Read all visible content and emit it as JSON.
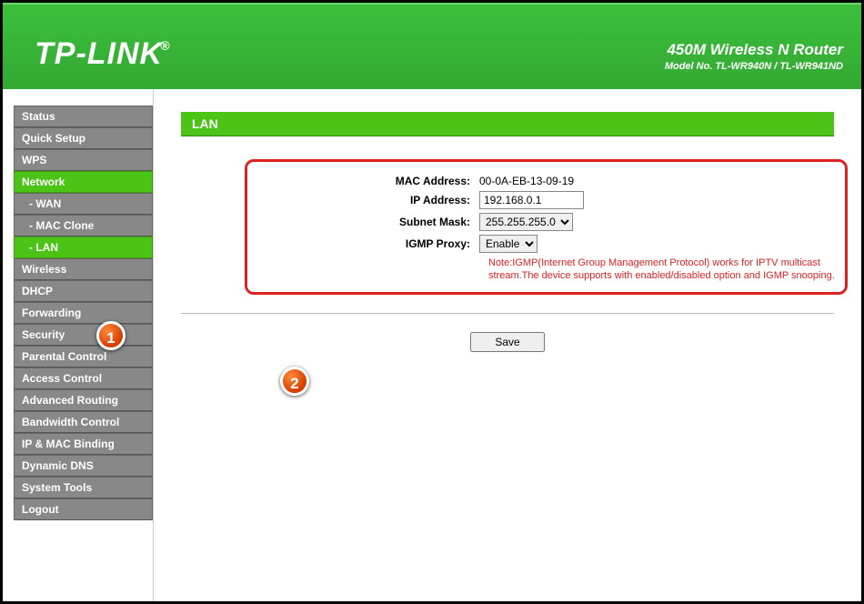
{
  "header": {
    "logo": "TP-LINK",
    "reg": "®",
    "title": "450M Wireless N Router",
    "model": "Model No. TL-WR940N / TL-WR941ND"
  },
  "sidebar": {
    "items": [
      {
        "label": "Status",
        "type": "top"
      },
      {
        "label": "Quick Setup",
        "type": "top"
      },
      {
        "label": "WPS",
        "type": "top"
      },
      {
        "label": "Network",
        "type": "top",
        "active": true
      },
      {
        "label": "- WAN",
        "type": "sub"
      },
      {
        "label": "- MAC Clone",
        "type": "sub"
      },
      {
        "label": "- LAN",
        "type": "sub",
        "active": true
      },
      {
        "label": "Wireless",
        "type": "top"
      },
      {
        "label": "DHCP",
        "type": "top"
      },
      {
        "label": "Forwarding",
        "type": "top"
      },
      {
        "label": "Security",
        "type": "top"
      },
      {
        "label": "Parental Control",
        "type": "top"
      },
      {
        "label": "Access Control",
        "type": "top"
      },
      {
        "label": "Advanced Routing",
        "type": "top"
      },
      {
        "label": "Bandwidth Control",
        "type": "top"
      },
      {
        "label": "IP & MAC Binding",
        "type": "top"
      },
      {
        "label": "Dynamic DNS",
        "type": "top"
      },
      {
        "label": "System Tools",
        "type": "top"
      },
      {
        "label": "Logout",
        "type": "top"
      }
    ]
  },
  "page": {
    "title": "LAN",
    "form": {
      "mac_label": "MAC Address:",
      "mac_value": "00-0A-EB-13-09-19",
      "ip_label": "IP Address:",
      "ip_value": "192.168.0.1",
      "mask_label": "Subnet Mask:",
      "mask_options": [
        "255.255.255.0"
      ],
      "mask_selected": "255.255.255.0",
      "igmp_label": "IGMP Proxy:",
      "igmp_options": [
        "Enable"
      ],
      "igmp_selected": "Enable",
      "note": "Note:IGMP(Internet Group Management Protocol) works for IPTV multicast stream.The device supports with enabled/disabled option and IGMP snooping.",
      "save_label": "Save"
    }
  },
  "annotations": {
    "badge1": "1",
    "badge2": "2"
  }
}
